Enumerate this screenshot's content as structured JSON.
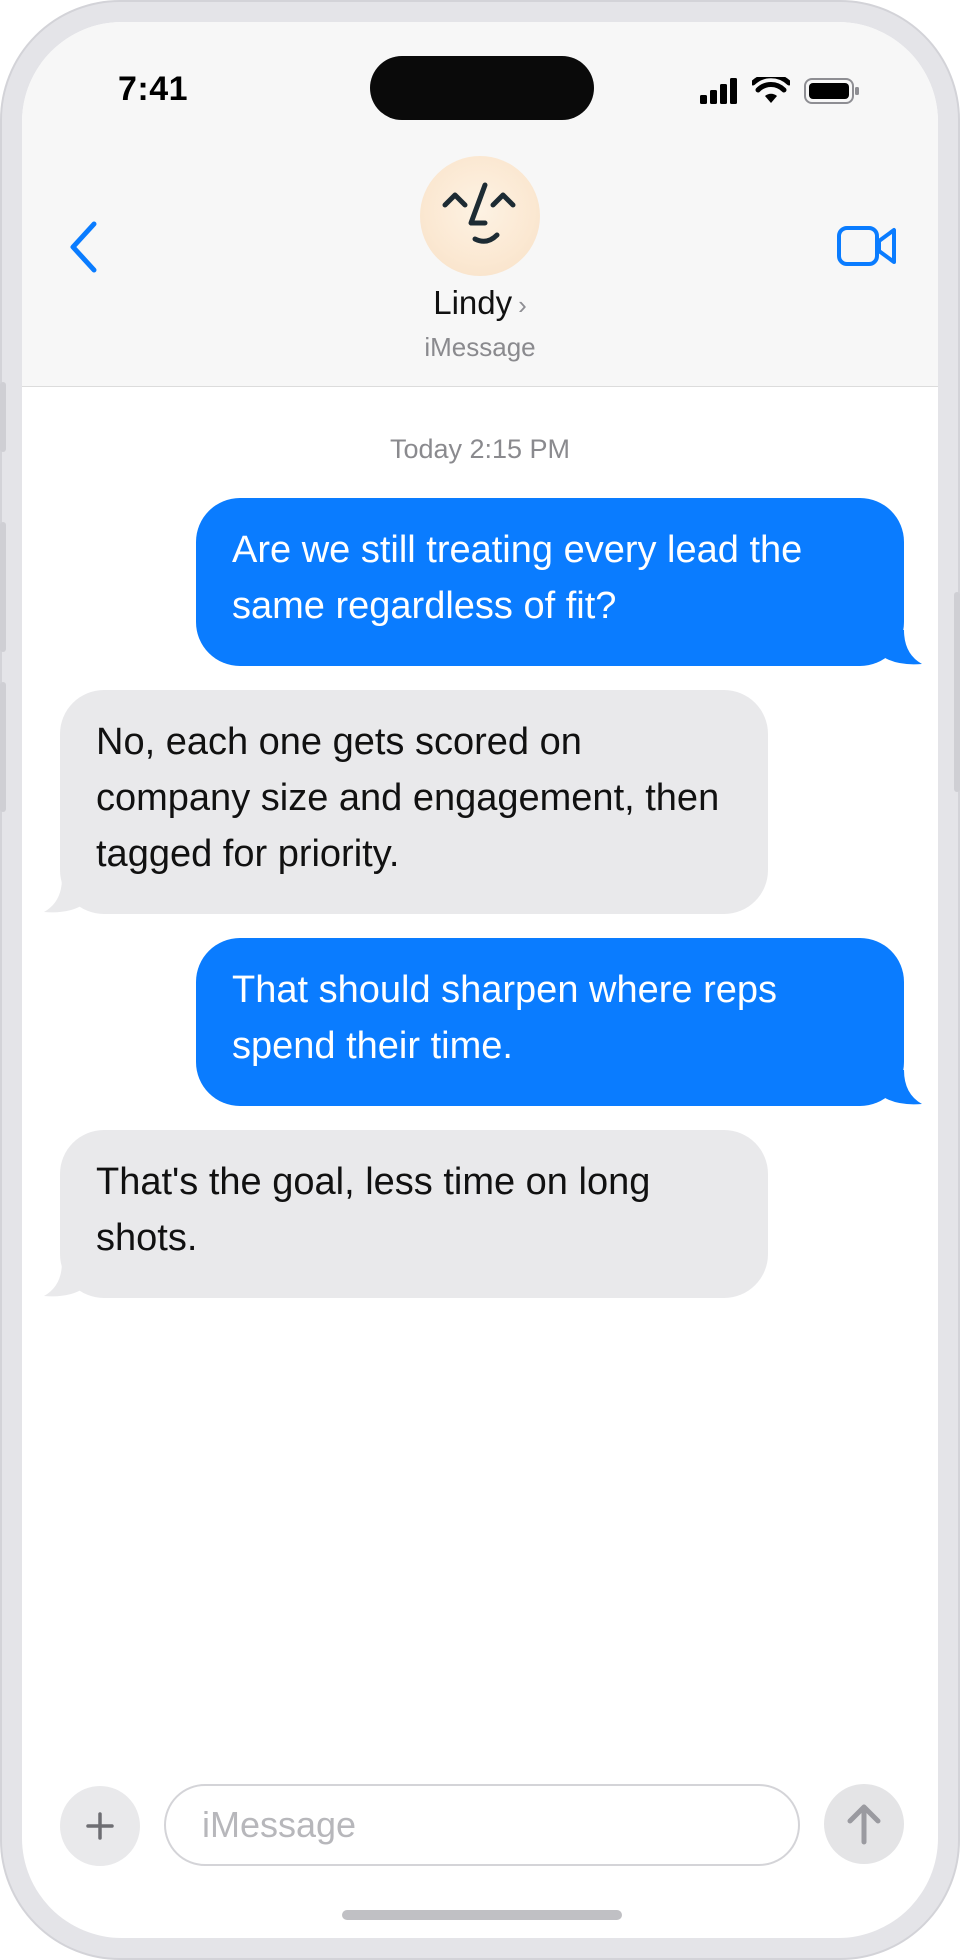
{
  "status_bar": {
    "time": "7:41"
  },
  "header": {
    "contact_name": "Lindy",
    "contact_chevron": "›",
    "service": "iMessage",
    "icons": {
      "back": "chevron-left-icon",
      "video": "video-camera-icon",
      "avatar": "face-doodle-icon"
    }
  },
  "conversation": {
    "timestamp": "Today 2:15 PM",
    "messages": [
      {
        "direction": "outgoing",
        "text": "Are we still treating every lead the same regardless of fit?"
      },
      {
        "direction": "incoming",
        "text": "No, each one gets scored on company size and engagement, then tagged for priority."
      },
      {
        "direction": "outgoing",
        "text": "That should sharpen where reps spend their time."
      },
      {
        "direction": "incoming",
        "text": "That's the goal, less time on long shots."
      }
    ]
  },
  "composer": {
    "placeholder": "iMessage",
    "value": "",
    "icons": {
      "add": "plus-icon",
      "send": "arrow-up-icon"
    }
  },
  "colors": {
    "accent": "#0a7cff",
    "incoming_bubble": "#e9e9eb",
    "header_bg": "#f7f7f7"
  }
}
